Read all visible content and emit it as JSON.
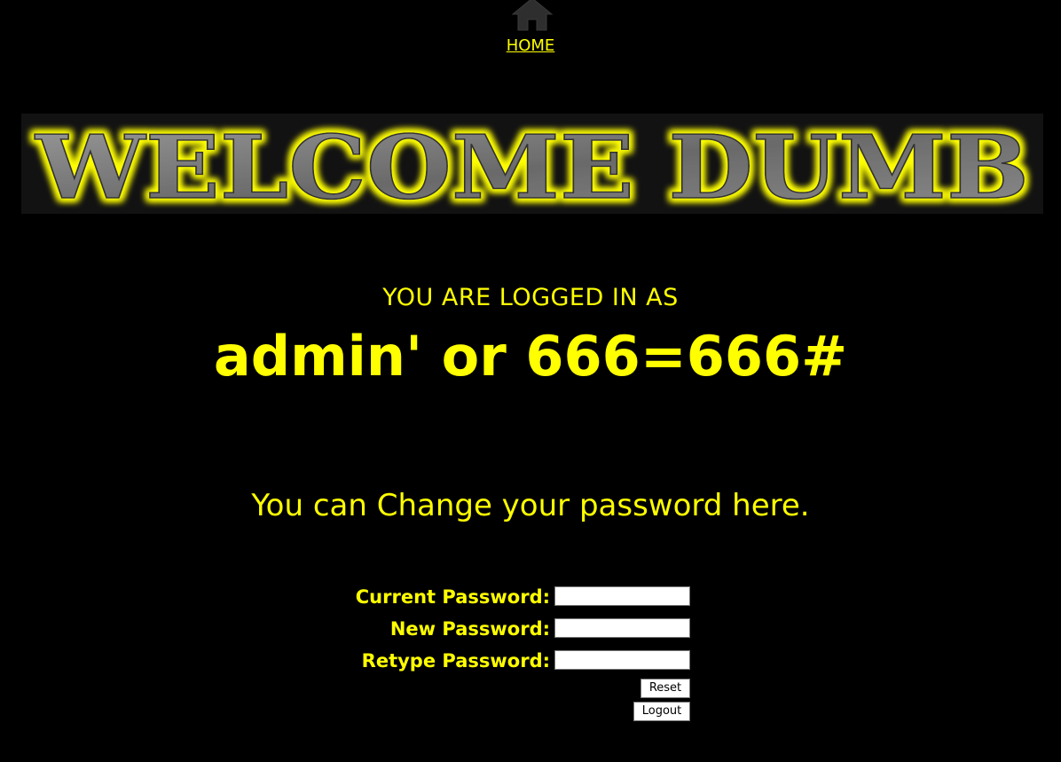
{
  "nav": {
    "home_icon": "home-icon",
    "home_label": "HOME"
  },
  "banner": {
    "text": "WELCOME DUMB",
    "text_color": "#7a7a7a",
    "glow_color": "#ffff00"
  },
  "session": {
    "logged_in_label": "YOU ARE LOGGED IN AS",
    "username": "admin' or 666=666#"
  },
  "change_password": {
    "message": "You can Change your password here.",
    "current_label": "Current Password:",
    "current_value": "",
    "new_label": "New Password:",
    "new_value": "",
    "retype_label": "Retype Password:",
    "retype_value": "",
    "reset_button": "Reset",
    "logout_button": "Logout"
  },
  "colors": {
    "background": "#000000",
    "accent": "#ffff00"
  }
}
